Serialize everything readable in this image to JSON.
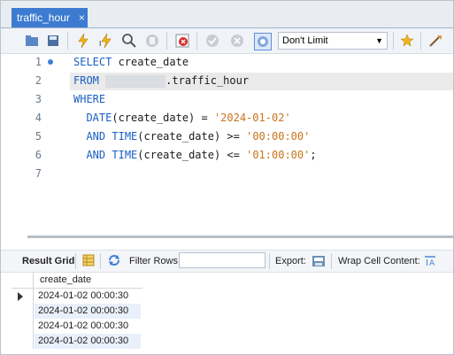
{
  "tab": {
    "title": "traffic_hour",
    "close_glyph": "×"
  },
  "toolbar": {
    "limit_select": "Don't Limit",
    "icons": [
      "open-file-icon",
      "save-icon",
      "execute-icon",
      "execute-current-icon",
      "explain-icon",
      "stop-icon",
      "toggle-error-icon",
      "commit-icon",
      "rollback-icon",
      "autocommit-icon",
      "bookmark-icon",
      "beautify-icon"
    ]
  },
  "editor": {
    "lines": [
      {
        "n": "1",
        "t": "SELECT create_date"
      },
      {
        "n": "2",
        "t": ".traffic_hour"
      },
      {
        "n": "3",
        "t": "WHERE"
      },
      {
        "n": "4",
        "t": "DATE(create_date) = '2024-01-02'"
      },
      {
        "n": "5",
        "t": "AND TIME(create_date) >= '00:00:00'"
      },
      {
        "n": "6",
        "t": "AND TIME(create_date) <= '01:00:00';"
      },
      {
        "n": "7",
        "t": ""
      }
    ],
    "kw_from": "FROM",
    "kw_select": "SELECT",
    "kw_where": "WHERE",
    "fn_date": "DATE",
    "and": "AND",
    "fn_time": "TIME"
  },
  "results": {
    "result_grid_label": "Result Grid",
    "filter_rows_label": "Filter Rows:",
    "export_label": "Export:",
    "wrap_label": "Wrap Cell Content:",
    "column": "create_date",
    "rows": [
      "2024-01-02 00:00:30",
      "2024-01-02 00:00:30",
      "2024-01-02 00:00:30",
      "2024-01-02 00:00:30"
    ]
  }
}
